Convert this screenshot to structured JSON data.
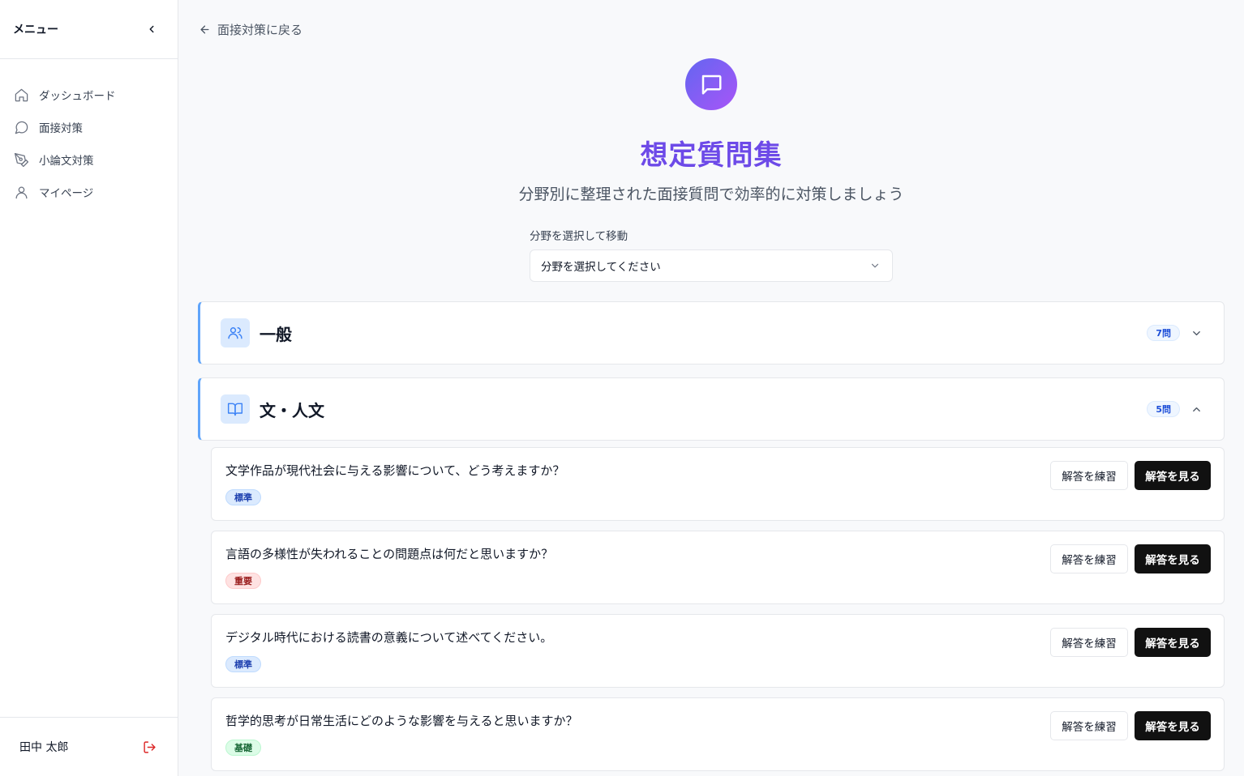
{
  "sidebar": {
    "title": "メニュー",
    "items": [
      {
        "label": "ダッシュボード",
        "icon": "home-icon"
      },
      {
        "label": "面接対策",
        "icon": "chat-bubble-icon"
      },
      {
        "label": "小論文対策",
        "icon": "pen-tool-icon"
      },
      {
        "label": "マイページ",
        "icon": "user-icon"
      }
    ],
    "user_name": "田中 太郎"
  },
  "main": {
    "back_label": "面接対策に戻る",
    "title": "想定質問集",
    "subtitle": "分野別に整理された面接質問で効率的に対策しましょう",
    "select_label": "分野を選択して移動",
    "select_placeholder": "分野を選択してください",
    "categories": [
      {
        "title": "一般",
        "count": "7問",
        "expanded": false
      },
      {
        "title": "文・人文",
        "count": "5問",
        "expanded": true
      }
    ],
    "questions": [
      {
        "text": "文学作品が現代社会に与える影響について、どう考えますか？",
        "badge": "標準",
        "level": "standard"
      },
      {
        "text": "言語の多様性が失われることの問題点は何だと思いますか？",
        "badge": "重要",
        "level": "important"
      },
      {
        "text": "デジタル時代における読書の意義について述べてください。",
        "badge": "標準",
        "level": "standard"
      },
      {
        "text": "哲学的思考が日常生活にどのような影響を与えると思いますか？",
        "badge": "基礎",
        "level": "basic"
      }
    ],
    "practice_label": "解答を練習",
    "view_label": "解答を見る"
  },
  "colors": {
    "accent": "#6d4ae8",
    "category_border": "#60a5fa",
    "logout": "#dc2626"
  }
}
